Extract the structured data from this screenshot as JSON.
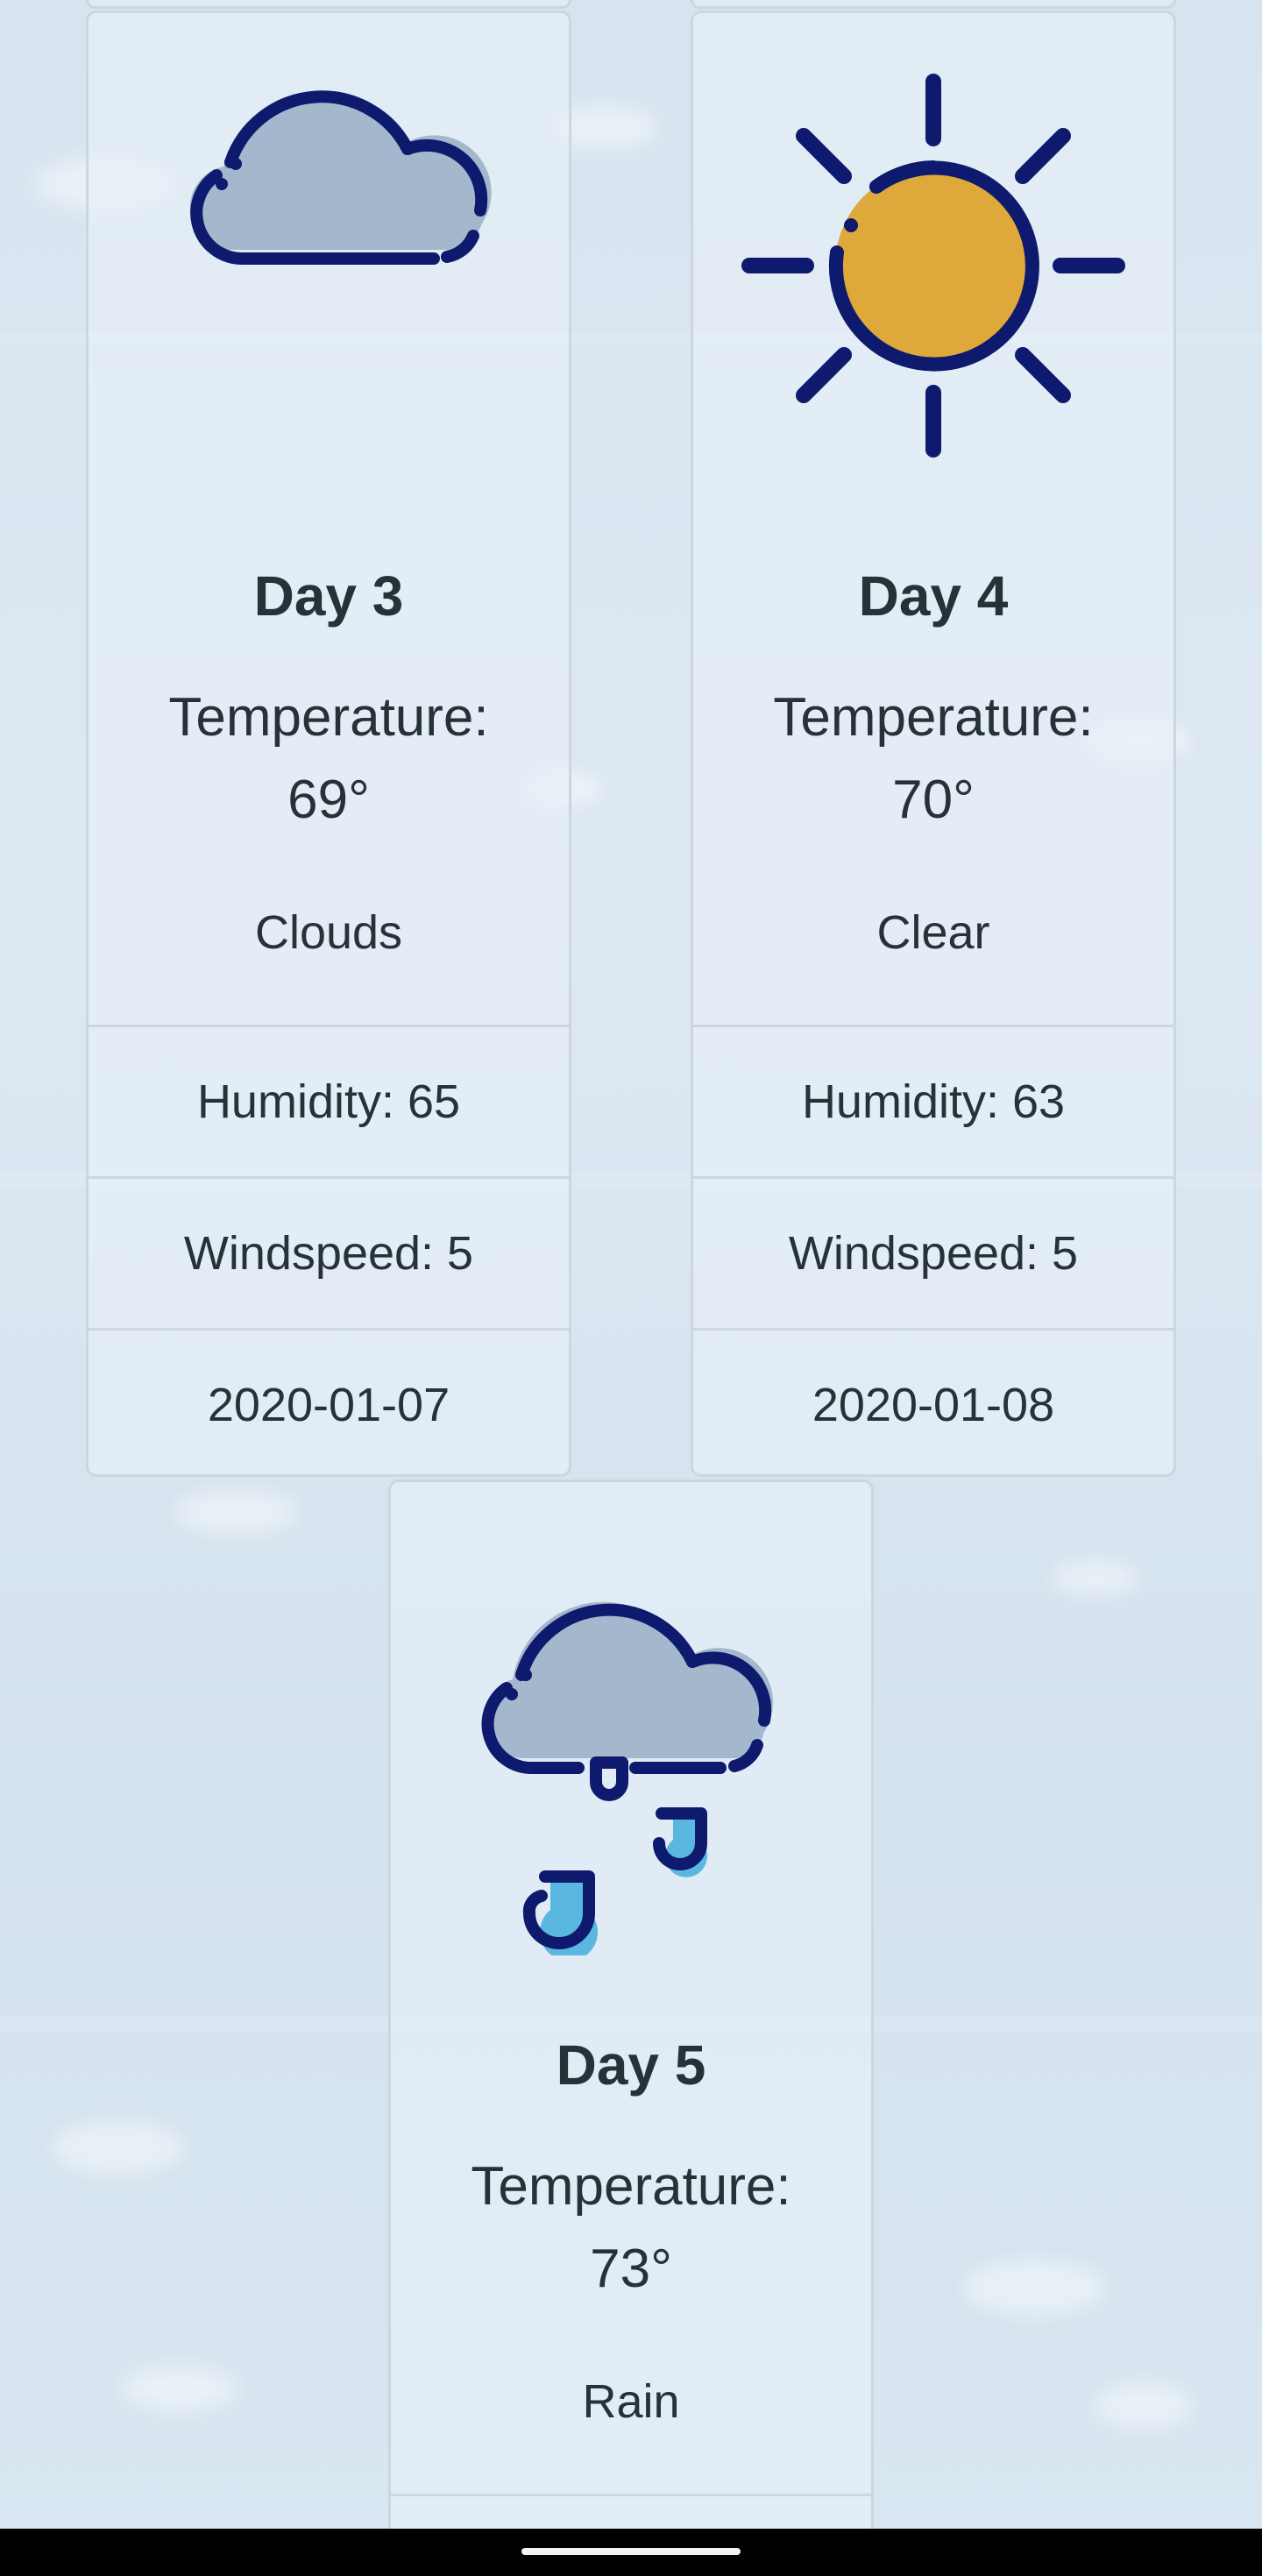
{
  "forecast": {
    "cards": [
      {
        "day": "Day 3",
        "temperature_label": "Temperature:",
        "temperature": "69°",
        "condition": "Clouds",
        "humidity": "Humidity: 65",
        "windspeed": "Windspeed: 5",
        "date": "2020-01-07",
        "icon": "cloud-icon"
      },
      {
        "day": "Day 4",
        "temperature_label": "Temperature:",
        "temperature": "70°",
        "condition": "Clear",
        "humidity": "Humidity: 63",
        "windspeed": "Windspeed: 5",
        "date": "2020-01-08",
        "icon": "sun-icon"
      },
      {
        "day": "Day 5",
        "temperature_label": "Temperature:",
        "temperature": "73°",
        "condition": "Rain",
        "icon": "rain-cloud-icon"
      }
    ]
  },
  "colors": {
    "icon_outline": "#0d1a6e",
    "cloud_fill": "#a3b8cc",
    "sun_fill": "#dea83a",
    "rain_fill": "#5ab8e0",
    "text": "#263238"
  }
}
